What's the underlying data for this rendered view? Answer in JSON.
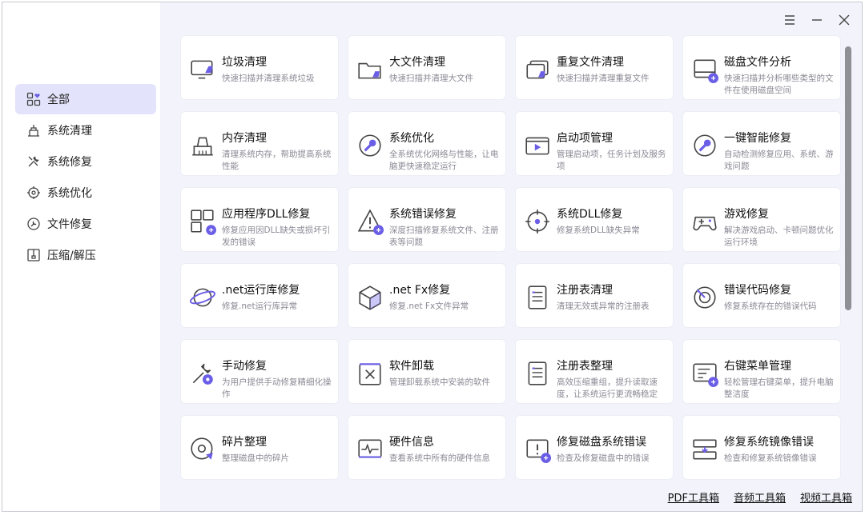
{
  "colors": {
    "accent": "#6b5ee6",
    "stroke": "#444444",
    "active_bg": "#e3e3fb"
  },
  "titlebar": {
    "menu_icon": "menu-icon",
    "minimize_icon": "minimize-icon",
    "close_icon": "close-icon"
  },
  "sidebar": {
    "items": [
      {
        "label": "全部",
        "icon": "grid-heart-icon",
        "active": true
      },
      {
        "label": "系统清理",
        "icon": "clean-icon",
        "active": false
      },
      {
        "label": "系统修复",
        "icon": "tools-icon",
        "active": false
      },
      {
        "label": "系统优化",
        "icon": "target-icon",
        "active": false
      },
      {
        "label": "文件修复",
        "icon": "file-repair-icon",
        "active": false
      },
      {
        "label": "压缩/解压",
        "icon": "archive-icon",
        "active": false
      }
    ]
  },
  "cards": [
    {
      "title": "垃圾清理",
      "desc": "快速扫描并清理系统垃圾",
      "icon": "monitor-broom-icon"
    },
    {
      "title": "大文件清理",
      "desc": "快速扫描并清理大文件",
      "icon": "folder-broom-icon"
    },
    {
      "title": "重复文件清理",
      "desc": "快速扫描并清理重复文件",
      "icon": "duplicate-files-icon"
    },
    {
      "title": "磁盘文件分析",
      "desc": "快速扫描并分析哪些类型的文件在使用磁盘空间",
      "icon": "disk-analysis-icon"
    },
    {
      "title": "内存清理",
      "desc": "清理系统内存，帮助提高系统性能",
      "icon": "memory-broom-icon"
    },
    {
      "title": "系统优化",
      "desc": "全系统优化网络与性能，让电脑更快速稳定运行",
      "icon": "wrench-circle-icon"
    },
    {
      "title": "启动项管理",
      "desc": "管理启动项，任务计划及服务项",
      "icon": "startup-icon"
    },
    {
      "title": "一键智能修复",
      "desc": "自动检测修复应用、系统、游戏问题",
      "icon": "smart-repair-icon"
    },
    {
      "title": "应用程序DLL修复",
      "desc": "修复应用因DLL缺失或损坏引发的错误",
      "icon": "app-dll-icon"
    },
    {
      "title": "系统错误修复",
      "desc": "深度扫描修复系统文件、注册表等问题",
      "icon": "warning-icon"
    },
    {
      "title": "系统DLL修复",
      "desc": "修复系统DLL缺失异常",
      "icon": "crosshair-icon"
    },
    {
      "title": "游戏修复",
      "desc": "解决游戏启动、卡顿问题优化运行环境",
      "icon": "gamepad-icon"
    },
    {
      "title": ".net运行库修复",
      "desc": "修复.net运行库异常",
      "icon": "planet-icon"
    },
    {
      "title": ".net Fx修复",
      "desc": "修复.net Fx文件异常",
      "icon": "cube-icon"
    },
    {
      "title": "注册表清理",
      "desc": "清理无效或异常的注册表",
      "icon": "registry-clean-icon"
    },
    {
      "title": "错误代码修复",
      "desc": "修复系统存在的错误代码",
      "icon": "error-code-icon"
    },
    {
      "title": "手动修复",
      "desc": "为用户提供手动修复精细化操作",
      "icon": "manual-repair-icon"
    },
    {
      "title": "软件卸载",
      "desc": "管理卸载系统中安装的软件",
      "icon": "uninstall-icon"
    },
    {
      "title": "注册表整理",
      "desc": "高效压缩重组，提升读取速度，让系统运行更流畅稳定",
      "icon": "registry-tidy-icon"
    },
    {
      "title": "右键菜单管理",
      "desc": "轻松管理右键菜单，提升电脑整洁度",
      "icon": "context-menu-icon"
    },
    {
      "title": "碎片整理",
      "desc": "整理磁盘中的碎片",
      "icon": "defrag-icon"
    },
    {
      "title": "硬件信息",
      "desc": "查看系统中所有的硬件信息",
      "icon": "hardware-icon"
    },
    {
      "title": "修复磁盘系统错误",
      "desc": "检查及修复磁盘中的错误",
      "icon": "disk-error-icon"
    },
    {
      "title": "修复系统镜像错误",
      "desc": "检查和修复系统镜像错误",
      "icon": "image-repair-icon"
    }
  ],
  "footer": {
    "links": [
      "PDF工具箱",
      "音频工具箱",
      "视频工具箱"
    ]
  }
}
